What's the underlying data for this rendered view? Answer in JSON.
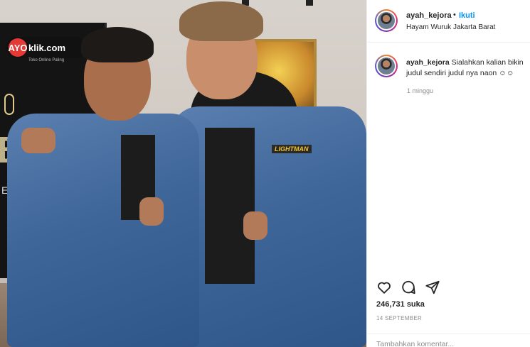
{
  "post": {
    "username": "ayah_kejora",
    "dot": "•",
    "follow_label": "Ikuti",
    "location": "Hayam Wuruk Jakarta Barat",
    "caption": {
      "username": "ayah_kejora",
      "text": "Sialahkan kalian bikin judul sendiri judul nya naon ☺☺"
    },
    "caption_time": "1 minggu",
    "likes": "246,731 suka",
    "date": "14 SEPTEMBER",
    "comment_placeholder": "Tambahkan komentar..."
  },
  "photo": {
    "banner_logo": "AYO",
    "banner_logo_suffix": "klik.com",
    "banner_tagline": "Toko Online Paling",
    "banner_big": "B",
    "banner_word": "ERVI",
    "jacket_patch": "LIGHTMAN"
  },
  "icons": {
    "like": "heart-icon",
    "comment": "comment-icon",
    "share": "share-icon"
  },
  "colors": {
    "accent": "#0095f6",
    "text": "#262626",
    "muted": "#8e8e8e",
    "divider": "#efefef"
  }
}
